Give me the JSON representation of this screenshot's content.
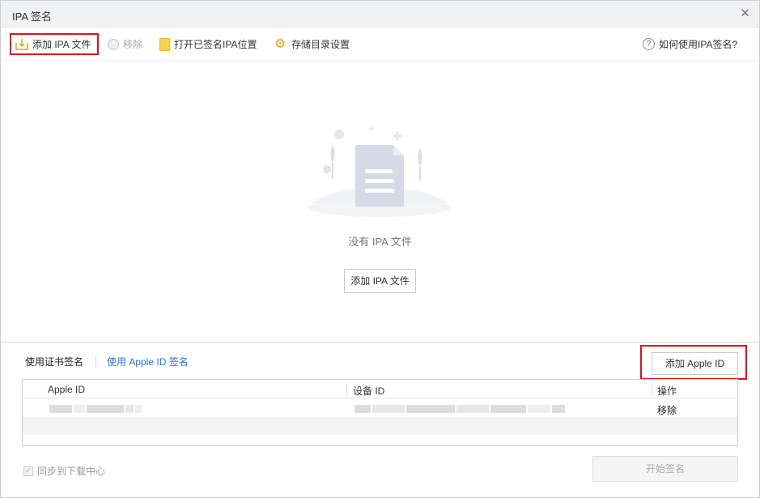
{
  "window": {
    "title": "IPA 签名"
  },
  "toolbar": {
    "add_ipa": "添加 IPA 文件",
    "remove": "移除",
    "open_signed": "打开已签名IPA位置",
    "storage_settings": "存储目录设置",
    "help": "如何使用IPA签名?"
  },
  "empty_state": {
    "message": "没有 IPA 文件",
    "add_button": "添加 IPA 文件"
  },
  "tabs": [
    {
      "label": "使用证书签名",
      "active": true
    },
    {
      "label": "使用 Apple ID 签名",
      "active": false
    }
  ],
  "add_apple_id_button": "添加 Apple ID",
  "table": {
    "headers": [
      "Apple ID",
      "设备 ID",
      "操作"
    ],
    "rows": [
      {
        "action": "移除"
      }
    ]
  },
  "footer": {
    "sync_label": "同步到下载中心",
    "start_button": "开始签名"
  },
  "colors": {
    "accent": "#2b74d6",
    "highlight_border": "#e0121d",
    "folder": "#f8d34e",
    "gear": "#e7a21d"
  }
}
